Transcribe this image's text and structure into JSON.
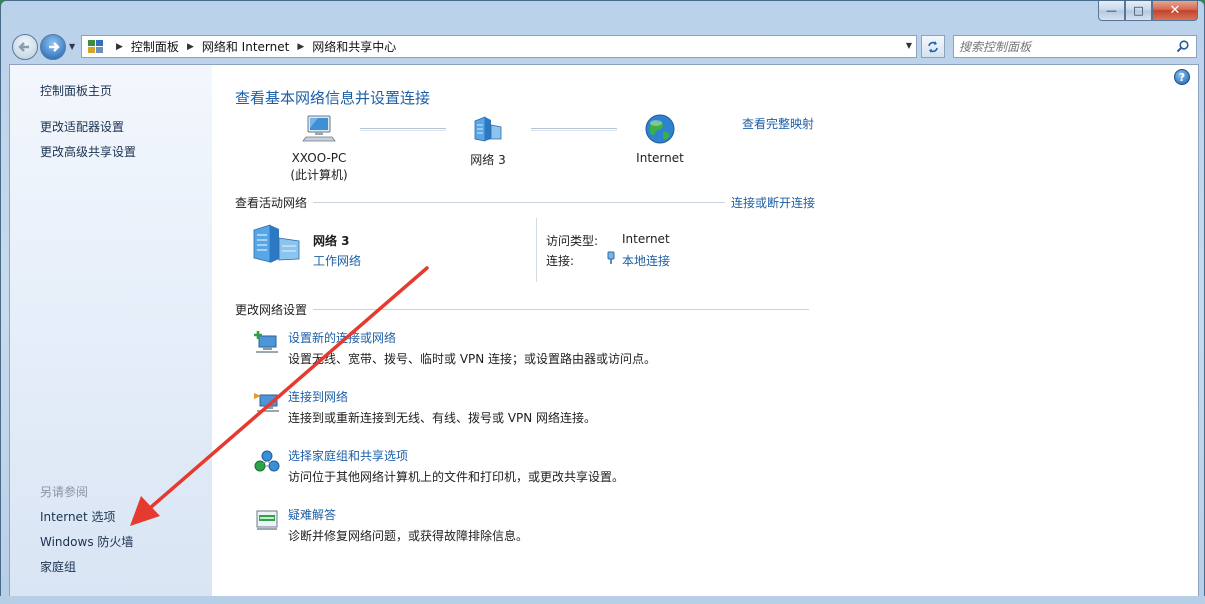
{
  "window": {
    "caption": {
      "minimize": "—",
      "maximize": "□",
      "close": "✕"
    }
  },
  "address_bar": {
    "crumbs": [
      "控制面板",
      "网络和 Internet",
      "网络和共享中心"
    ],
    "search_placeholder": "搜索控制面板"
  },
  "sidebar": {
    "links": [
      "控制面板主页",
      "更改适配器设置",
      "更改高级共享设置"
    ],
    "see_also_heading": "另请参阅",
    "see_also": [
      "Internet 选项",
      "Windows 防火墙",
      "家庭组"
    ]
  },
  "main": {
    "title": "查看基本网络信息并设置连接",
    "view_full_map": "查看完整映射",
    "map_nodes": [
      {
        "label": "XXOO-PC",
        "sublabel": "(此计算机)",
        "icon": "computer-icon"
      },
      {
        "label": "网络  3",
        "icon": "network-icon"
      },
      {
        "label": "Internet",
        "icon": "globe-icon"
      }
    ],
    "active_networks": {
      "title": "查看活动网络",
      "action": "连接或断开连接",
      "network_name": "网络  3",
      "network_type": "工作网络",
      "access_type_label": "访问类型:",
      "access_type_value": "Internet",
      "connections_label": "连接:",
      "connections_value": "本地连接"
    },
    "change_settings": {
      "title": "更改网络设置",
      "tasks": [
        {
          "title": "设置新的连接或网络",
          "desc": "设置无线、宽带、拨号、临时或 VPN 连接；或设置路由器或访问点。",
          "icon": "new-connection-icon"
        },
        {
          "title": "连接到网络",
          "desc": "连接到或重新连接到无线、有线、拨号或 VPN 网络连接。",
          "icon": "connect-network-icon"
        },
        {
          "title": "选择家庭组和共享选项",
          "desc": "访问位于其他网络计算机上的文件和打印机，或更改共享设置。",
          "icon": "homegroup-icon"
        },
        {
          "title": "疑难解答",
          "desc": "诊断并修复网络问题，或获得故障排除信息。",
          "icon": "troubleshoot-icon"
        }
      ]
    }
  },
  "colors": {
    "link": "#1d5fa6",
    "annotation_arrow": "#e53a2f"
  }
}
